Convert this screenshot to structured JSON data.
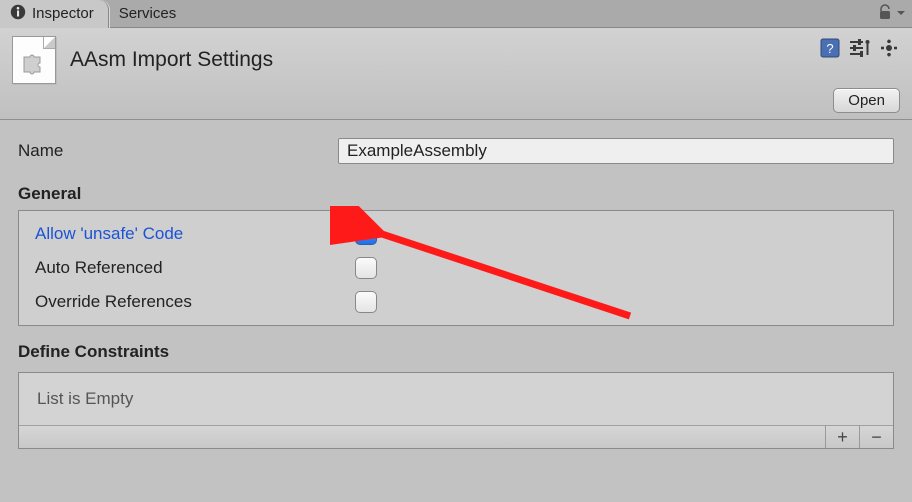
{
  "tabs": {
    "inspector": "Inspector",
    "services": "Services"
  },
  "header": {
    "title": "AAsm Import Settings",
    "open_button": "Open"
  },
  "name": {
    "label": "Name",
    "value": "ExampleAssembly"
  },
  "sections": {
    "general": "General",
    "define_constraints": "Define Constraints"
  },
  "general": {
    "allow_unsafe": {
      "label": "Allow 'unsafe' Code",
      "checked": true
    },
    "auto_referenced": {
      "label": "Auto Referenced",
      "checked": false
    },
    "override_references": {
      "label": "Override References",
      "checked": false
    }
  },
  "constraints": {
    "empty_text": "List is Empty",
    "add": "+",
    "remove": "−"
  }
}
